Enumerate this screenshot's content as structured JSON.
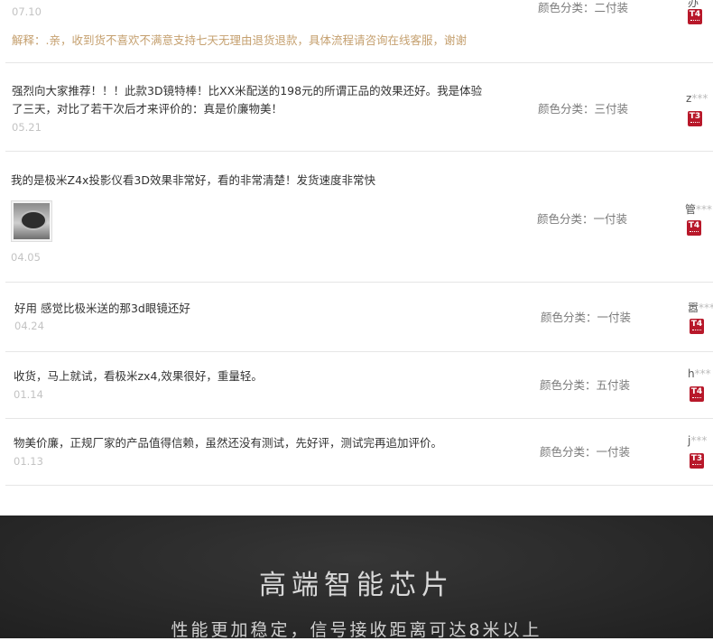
{
  "reviews": [
    {
      "date": "07.10",
      "reply": "解释：.亲，收到货不喜欢不满意支持七天无理由退货退款，具体流程请咨询在线客服，谢谢",
      "sku": "颜色分类：二付装",
      "user_initial": "办",
      "user_mask": "",
      "badge": "T4"
    },
    {
      "text_line1": "强烈向大家推荐！！！此款3D镜特棒！比XX米配送的198元的所谓正品的效果还好。我是体验",
      "text_line2": "了三天，对比了若干次后才来评价的：真是价廉物美！",
      "date": "05.21",
      "sku": "颜色分类：三付装",
      "user_initial": "z",
      "user_mask": "***",
      "badge": "T3"
    },
    {
      "text": "我的是极米Z4x投影仪看3D效果非常好，看的非常清楚！发货速度非常快",
      "photo_icon": "review-photo-thumbnail",
      "date": "04.05",
      "sku": "颜色分类：一付装",
      "user_initial": "管",
      "user_mask": "***",
      "badge": "T4"
    },
    {
      "text": "好用 感觉比极米送的那3d眼镜还好",
      "date": "04.24",
      "sku": "颜色分类：一付装",
      "user_initial": "嚣",
      "user_mask": "***",
      "badge": "T4"
    },
    {
      "text": "收货，马上就试，看极米zx4,效果很好，重量轻。",
      "date": "01.14",
      "sku": "颜色分类：五付装",
      "user_initial": "h",
      "user_mask": "***",
      "badge": "T4"
    },
    {
      "text": "物美价廉，正规厂家的产品值得信赖，虽然还没有测试，先好评，测试完再追加评价。",
      "date": "01.13",
      "sku": "颜色分类：一付装",
      "user_initial": "j",
      "user_mask": "***",
      "badge": "T3"
    }
  ],
  "banner": {
    "headline": "高端智能芯片",
    "subline": "性能更加稳定，信号接收距离可达8米以上"
  },
  "colors": {
    "reply_text": "#c5a06f",
    "date_text": "#c3c3c3",
    "badge_red": "#b8182a",
    "footer_bg": "#2a2a2a"
  }
}
